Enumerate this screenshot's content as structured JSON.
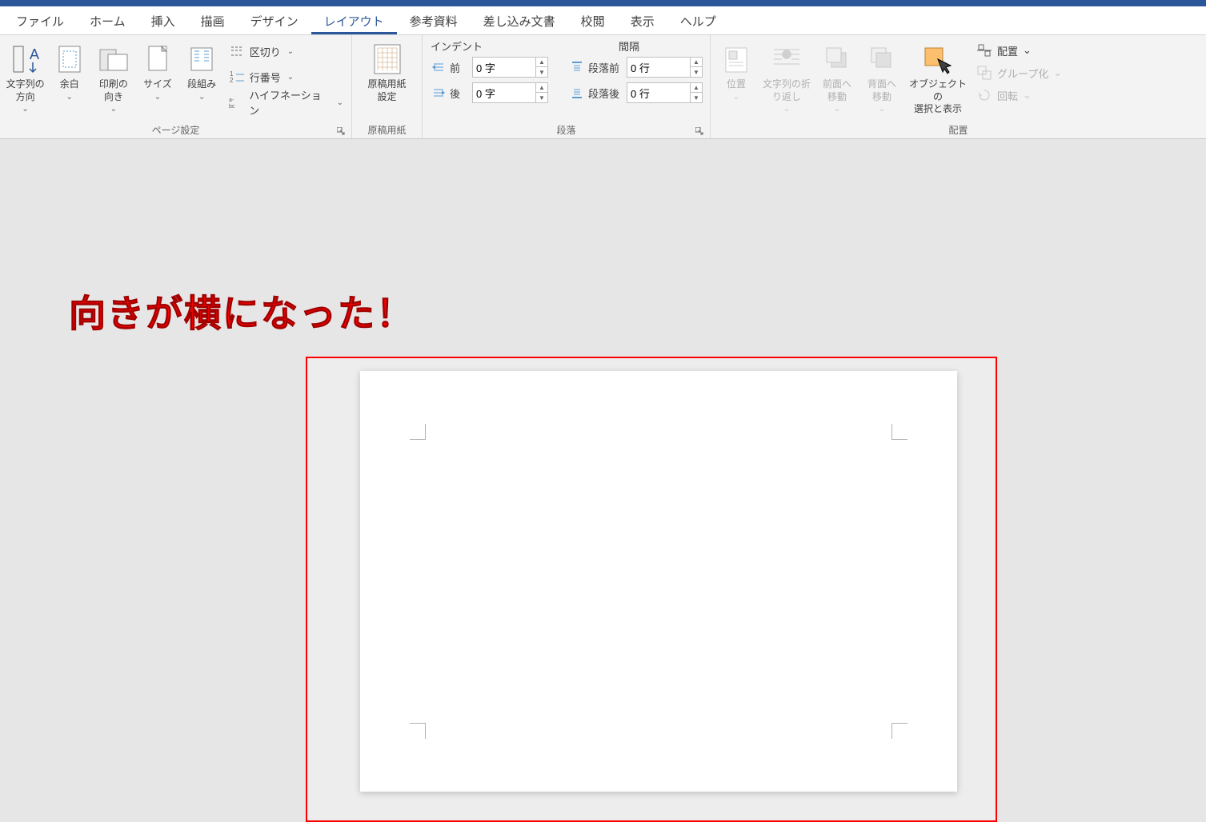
{
  "tabs": {
    "file": "ファイル",
    "home": "ホーム",
    "insert": "挿入",
    "draw": "描画",
    "design": "デザイン",
    "layout": "レイアウト",
    "references": "参考資料",
    "mailmerge": "差し込み文書",
    "review": "校閲",
    "view": "表示",
    "help": "ヘルプ"
  },
  "groups": {
    "page_setup": {
      "label": "ページ設定",
      "text_dir": "文字列の\n方向",
      "margins": "余白",
      "orientation": "印刷の\n向き",
      "size": "サイズ",
      "columns": "段組み",
      "breaks": "区切り",
      "line_numbers": "行番号",
      "hyphenation": "ハイフネーション"
    },
    "manuscript": {
      "label": "原稿用紙",
      "settings": "原稿用紙\n設定"
    },
    "paragraph": {
      "label": "段落",
      "indent_head": "インデント",
      "spacing_head": "間隔",
      "before_label": "前",
      "after_label": "後",
      "para_before_label": "段落前",
      "para_after_label": "段落後",
      "indent_before_val": "0 字",
      "indent_after_val": "0 字",
      "space_before_val": "0 行",
      "space_after_val": "0 行"
    },
    "arrange": {
      "label": "配置",
      "position": "位置",
      "wrap": "文字列の折\nり返し",
      "bring_fwd": "前面へ\n移動",
      "send_back": "背面へ\n移動",
      "selection": "オブジェクトの\n選択と表示",
      "align": "配置",
      "group": "グループ化",
      "rotate": "回転"
    }
  },
  "annotation": "向きが横になった！",
  "dropdown_glyph": "⌄"
}
